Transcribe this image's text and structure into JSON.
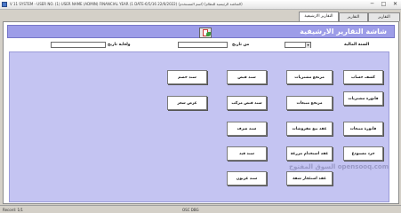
{
  "window": {
    "title": "V 11 SYSTEM - USER NO. (1) USER NAME (ADMIN) FINANCIAL YEAR (1 DATE-6/5/16 22/6/2022)    (اسم المستخدم)    (الشاشة الرئيسية للنظام)",
    "minimize_label": "─",
    "maximize_label": "□",
    "close_label": "✕"
  },
  "tabs": [
    {
      "label": "التقارير الرئيسية"
    },
    {
      "label": "التقارير الخاصة"
    },
    {
      "label": "التقارير الارشيفية"
    }
  ],
  "header": {
    "title": "شاشة التقارير الارشيفية",
    "icon": "report-icon"
  },
  "filters": {
    "fiscal_year_label": "السنة المالية",
    "fiscal_year_value": "",
    "from_date_label": "من تاريخ",
    "from_date_value": "",
    "to_date_label": "ولغاية تاريخ",
    "to_date_value": ""
  },
  "buttons": {
    "account_statement": "كشف حساب",
    "purchase_returns": "مرتجع مشتريات",
    "receipt_voucher": "سند قبض",
    "discount_voucher": "سند خصم",
    "purchase_invoice": "فاتورة مشتريات",
    "sales_returns": "مرتجع مبيعات",
    "compound_receipt": "سند قبض مركب",
    "price_quote": "عرض سعر",
    "sales_invoice": "فاتورة مبيعات",
    "possessions_sale": "عقد بيع مقروشات",
    "payment_voucher": "سند صرف",
    "inventory_count": "جرد مستودع",
    "usage_contract": "عقد استخدام مزرعة",
    "journal_voucher": "سند قيد",
    "apartment_rent": "عقد استئجار شقة",
    "deposit_voucher": "سند عربون"
  },
  "status": {
    "record": "Record: 1/1",
    "center": "OSC  DBG"
  },
  "watermark": "السوق المفتوح opensooq.com",
  "colors": {
    "panel": "#c4c4f2",
    "header": "#9d9de8"
  }
}
